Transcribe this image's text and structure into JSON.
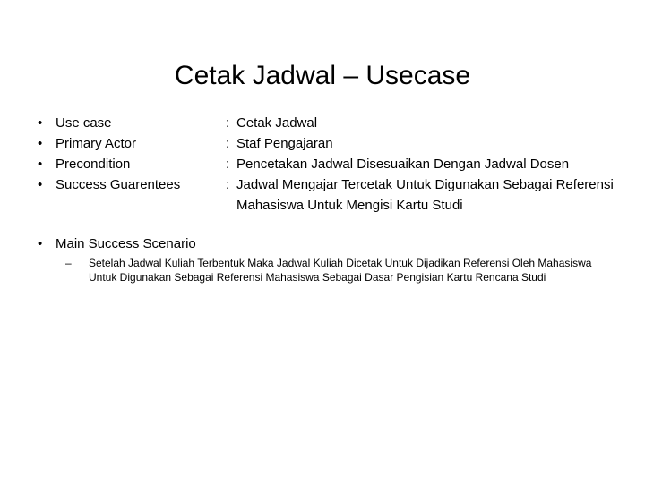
{
  "slide": {
    "title": "Cetak Jadwal – Usecase",
    "bullet_glyph": "•",
    "dash_glyph": "–",
    "colon": ":",
    "rows": [
      {
        "label": "Use case",
        "value": "Cetak Jadwal"
      },
      {
        "label": "Primary Actor",
        "value": "Staf Pengajaran"
      },
      {
        "label": "Precondition",
        "value": "Pencetakan Jadwal Disesuaikan Dengan Jadwal Dosen"
      },
      {
        "label": "Success Guarentees",
        "value": "Jadwal Mengajar Tercetak Untuk Digunakan Sebagai Referensi Mahasiswa Untuk Mengisi Kartu Studi"
      }
    ],
    "scenario_heading": "Main Success Scenario",
    "scenario_detail": "Setelah Jadwal Kuliah Terbentuk Maka Jadwal Kuliah Dicetak Untuk Dijadikan Referensi Oleh Mahasiswa Untuk Digunakan Sebagai Referensi Mahasiswa Sebagai Dasar Pengisian Kartu Rencana Studi"
  },
  "colors": {
    "background": "#ffffff",
    "text": "#000000"
  }
}
